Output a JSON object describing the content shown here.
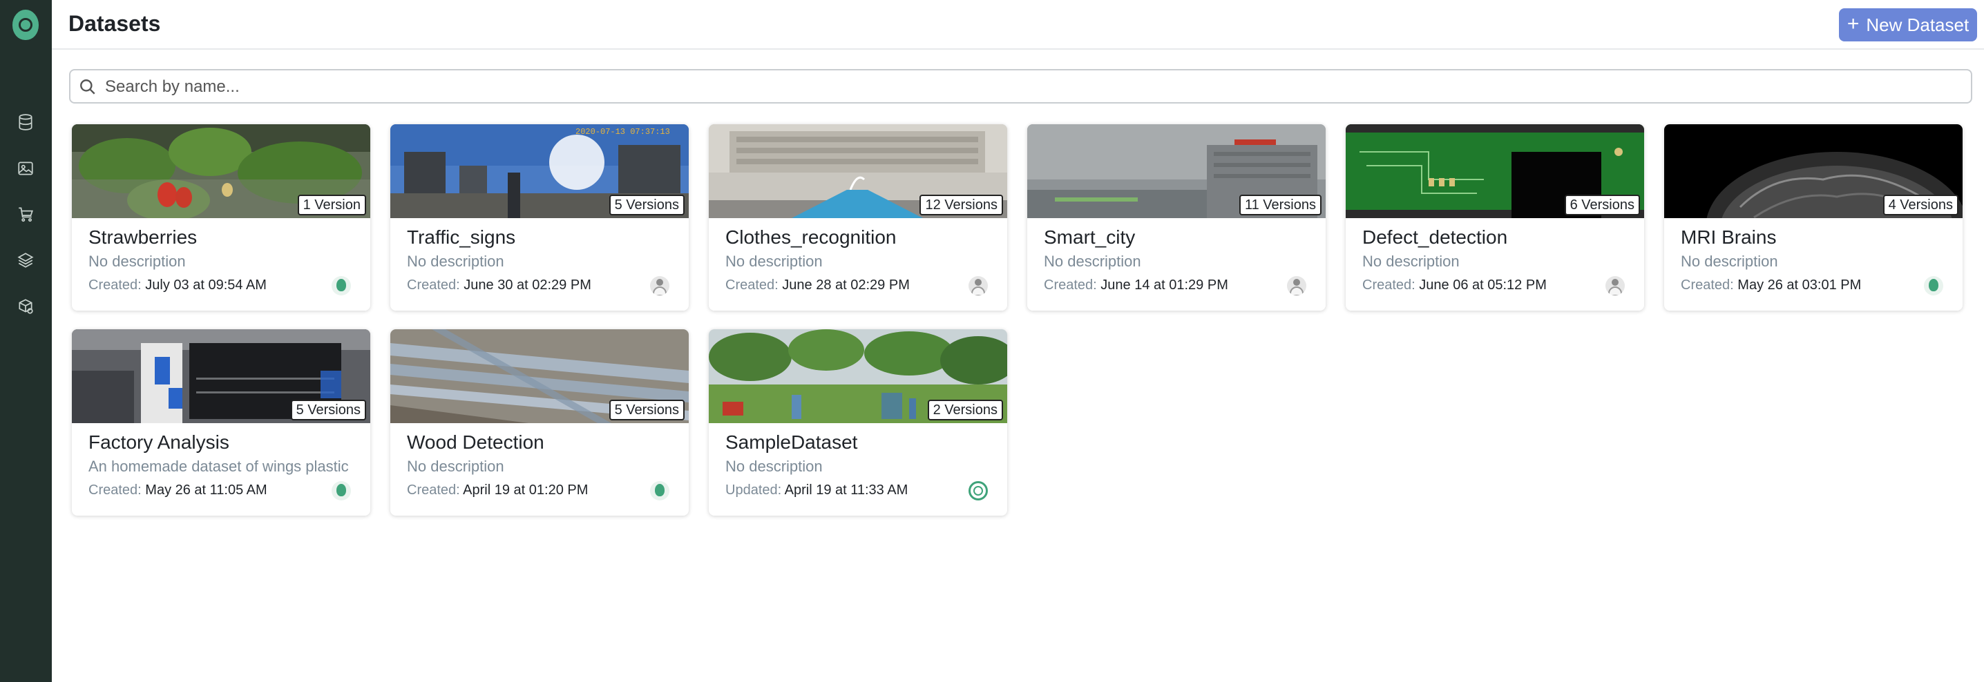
{
  "header": {
    "title": "Datasets",
    "new_button_label": "New Dataset"
  },
  "search": {
    "placeholder": "Search by name...",
    "value": ""
  },
  "sidebar": {
    "items": [
      {
        "icon": "database-icon"
      },
      {
        "icon": "image-icon"
      },
      {
        "icon": "store-icon"
      },
      {
        "icon": "layers-icon"
      },
      {
        "icon": "model-settings-icon"
      }
    ]
  },
  "datasets": [
    {
      "name": "Strawberries",
      "versions": "1 Version",
      "description": "No description",
      "date_key": "Created:",
      "date": "July 03 at 09:54 AM",
      "owner": "org"
    },
    {
      "name": "Traffic_signs",
      "versions": "5 Versions",
      "description": "No description",
      "date_key": "Created:",
      "date": "June 30 at 02:29 PM",
      "owner": "user",
      "thumb_stamp": "2020-07-13 07:37:13"
    },
    {
      "name": "Clothes_recognition",
      "versions": "12 Versions",
      "description": "No description",
      "date_key": "Created:",
      "date": "June 28 at 02:29 PM",
      "owner": "user"
    },
    {
      "name": "Smart_city",
      "versions": "11 Versions",
      "description": "No description",
      "date_key": "Created:",
      "date": "June 14 at 01:29 PM",
      "owner": "user"
    },
    {
      "name": "Defect_detection",
      "versions": "6 Versions",
      "description": "No description",
      "date_key": "Created:",
      "date": "June 06 at 05:12 PM",
      "owner": "user"
    },
    {
      "name": "MRI Brains",
      "versions": "4 Versions",
      "description": "No description",
      "date_key": "Created:",
      "date": "May 26 at 03:01 PM",
      "owner": "org"
    },
    {
      "name": "Factory Analysis",
      "versions": "5 Versions",
      "description": "An homemade dataset of wings plastic",
      "date_key": "Created:",
      "date": "May 26 at 11:05 AM",
      "owner": "org"
    },
    {
      "name": "Wood Detection",
      "versions": "5 Versions",
      "description": "No description",
      "date_key": "Created:",
      "date": "April 19 at 01:20 PM",
      "owner": "org"
    },
    {
      "name": "SampleDataset",
      "versions": "2 Versions",
      "description": "No description",
      "date_key": "Updated:",
      "date": "April 19 at 11:33 AM",
      "owner": "ring"
    }
  ],
  "colors": {
    "sidebar_bg": "#22302c",
    "accent": "#6b86d8",
    "brand_green": "#3fa37a"
  }
}
